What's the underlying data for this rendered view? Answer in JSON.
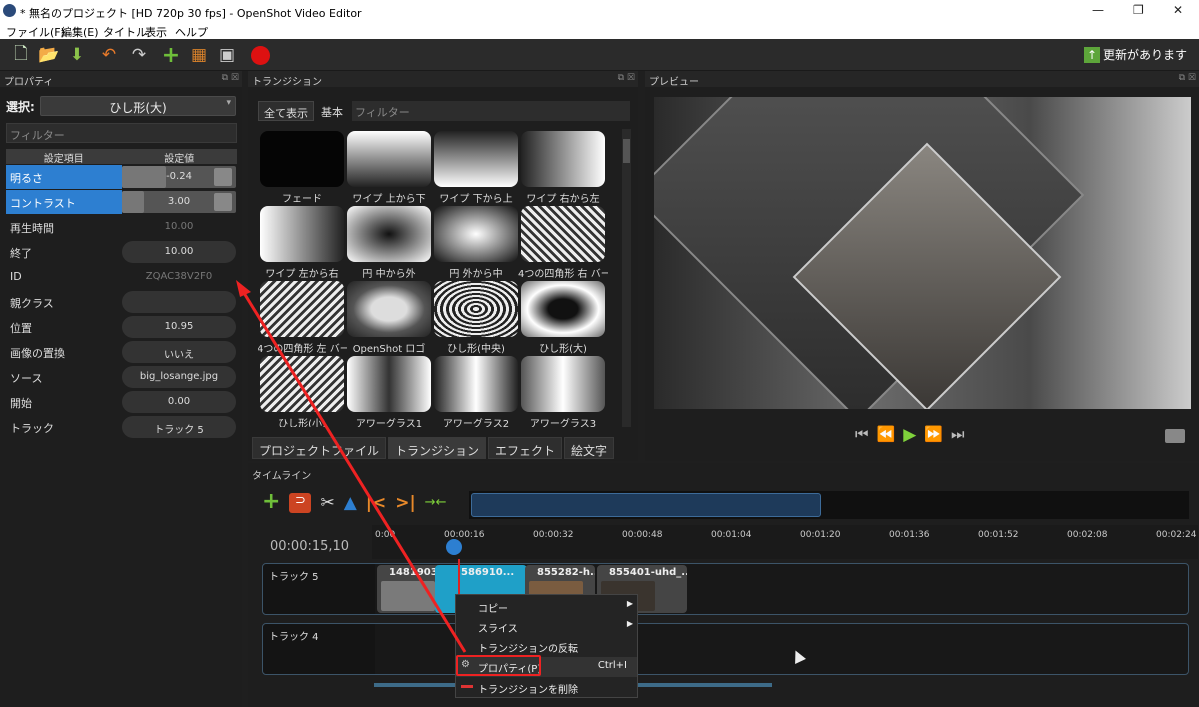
{
  "window": {
    "title": "* 無名のプロジェクト [HD 720p 30 fps] - OpenShot Video Editor",
    "controls": [
      "—",
      "❐",
      "✕"
    ]
  },
  "menu": [
    "ファイル(F)",
    "編集(E)",
    "タイトル",
    "表示",
    "ヘルプ"
  ],
  "toolbar": {
    "update_label": "更新があります"
  },
  "properties": {
    "title": "プロパティ",
    "select_label": "選択:",
    "select_value": "ひし形(大)",
    "filter_placeholder": "フィルター",
    "col_name": "設定項目",
    "col_value": "設定値",
    "rows": [
      {
        "name": "明るさ",
        "value": "-0.24"
      },
      {
        "name": "コントラスト",
        "value": "3.00"
      },
      {
        "name": "再生時間",
        "value": "10.00"
      },
      {
        "name": "終了",
        "value": "10.00"
      },
      {
        "name": "ID",
        "value": "ZQAC38V2F0"
      },
      {
        "name": "親クラス",
        "value": ""
      },
      {
        "name": "位置",
        "value": "10.95"
      },
      {
        "name": "画像の置換",
        "value": "いいえ"
      },
      {
        "name": "ソース",
        "value": "big_losange.jpg"
      },
      {
        "name": "開始",
        "value": "0.00"
      },
      {
        "name": "トラック",
        "value": "トラック 5"
      }
    ]
  },
  "transitions": {
    "title": "トランジション",
    "show_all": "全て表示",
    "basic": "基本",
    "filter_placeholder": "フィルター",
    "items": [
      "フェード",
      "ワイプ 上から下",
      "ワイプ 下から上",
      "ワイプ 右から左",
      "ワイプ 左から右",
      "円 中から外",
      "円 外から中",
      "4つの四角形 右 バー",
      "4つの四角形 左 バー",
      "OpenShot ロゴ",
      "ひし形(中央)",
      "ひし形(大)",
      "ひし形(小)",
      "アワーグラス1",
      "アワーグラス2",
      "アワーグラス3"
    ],
    "bottom_tabs": [
      "プロジェクトファイル",
      "トランジション",
      "エフェクト",
      "絵文字"
    ]
  },
  "preview": {
    "title": "プレビュー"
  },
  "timeline": {
    "title": "タイムライン",
    "current_time": "00:00:15,10",
    "ticks": [
      "0:00",
      "00:00:16",
      "00:00:32",
      "00:00:48",
      "00:01:04",
      "00:01:20",
      "00:01:36",
      "00:01:52",
      "00:02:08",
      "00:02:24"
    ],
    "tracks": [
      {
        "name": "トラック 5",
        "clips": [
          "1481903-hd...",
          "586910...",
          "855282-h...",
          "855401-uhd_..."
        ]
      },
      {
        "name": "トラック 4"
      }
    ]
  },
  "context_menu": {
    "copy": "コピー",
    "slice": "スライス",
    "reverse": "トランジションの反転",
    "properties": "プロパティ(P)",
    "properties_shortcut": "Ctrl+I",
    "delete": "トランジションを削除"
  },
  "colors": {
    "accent": "#2d7fd1",
    "highlight": "#e22222",
    "teal": "#1fa0c8"
  }
}
